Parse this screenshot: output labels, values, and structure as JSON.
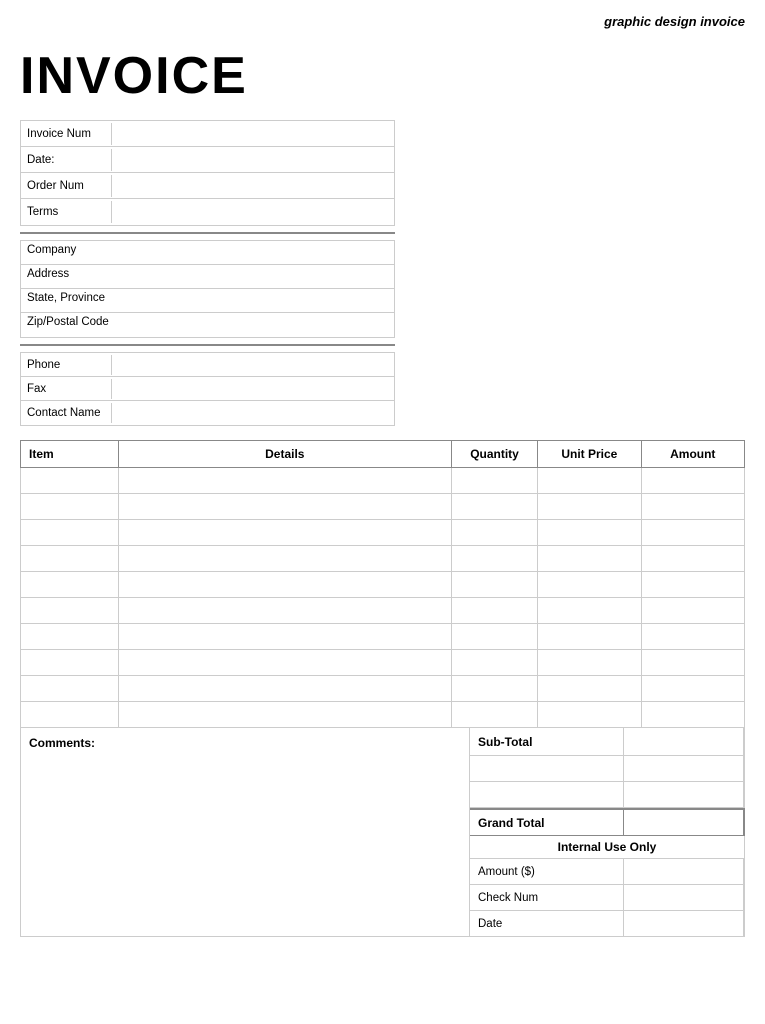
{
  "page": {
    "top_label": "graphic design invoice",
    "title": "INVOICE",
    "info_fields": [
      {
        "label": "Invoice Num",
        "value": ""
      },
      {
        "label": "Date:",
        "value": ""
      },
      {
        "label": "Order Num",
        "value": ""
      },
      {
        "label": "Terms",
        "value": ""
      }
    ],
    "address_fields": [
      {
        "label": "Company"
      },
      {
        "label": "Address"
      },
      {
        "label": "State, Province"
      },
      {
        "label": "Zip/Postal Code"
      }
    ],
    "contact_fields": [
      {
        "label": "Phone",
        "value": ""
      },
      {
        "label": "Fax",
        "value": ""
      },
      {
        "label": "Contact Name",
        "value": ""
      }
    ],
    "table": {
      "headers": [
        "Item",
        "Details",
        "Quantity",
        "Unit Price",
        "Amount"
      ],
      "rows": [
        [
          "",
          "",
          "",
          "",
          ""
        ],
        [
          "",
          "",
          "",
          "",
          ""
        ],
        [
          "",
          "",
          "",
          "",
          ""
        ],
        [
          "",
          "",
          "",
          "",
          ""
        ],
        [
          "",
          "",
          "",
          "",
          ""
        ],
        [
          "",
          "",
          "",
          "",
          ""
        ],
        [
          "",
          "",
          "",
          "",
          ""
        ],
        [
          "",
          "",
          "",
          "",
          ""
        ],
        [
          "",
          "",
          "",
          "",
          ""
        ],
        [
          "",
          "",
          "",
          "",
          ""
        ]
      ]
    },
    "comments_label": "Comments:",
    "totals": {
      "subtotal_label": "Sub-Total",
      "subtotal_value": "",
      "blank_row1": "",
      "blank_row2": "",
      "grand_total_label": "Grand Total",
      "grand_total_value": "",
      "internal_use_label": "Internal Use Only",
      "internal_rows": [
        {
          "label": "Amount ($)",
          "value": ""
        },
        {
          "label": "Check Num",
          "value": ""
        },
        {
          "label": "Date",
          "value": ""
        }
      ]
    }
  }
}
